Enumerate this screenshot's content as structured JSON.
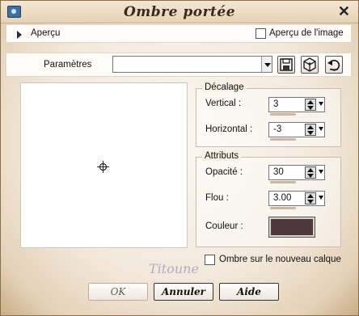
{
  "window": {
    "title": "Ombre portée",
    "close_glyph": "✕"
  },
  "apercu": {
    "label": "Aperçu",
    "image_preview_label": "Aperçu de l'image",
    "image_preview_checked": false
  },
  "presets": {
    "label": "Paramètres",
    "selected": ""
  },
  "offset": {
    "title": "Décalage",
    "vertical_label": "Vertical :",
    "vertical_value": "3",
    "horizontal_label": "Horizontal :",
    "horizontal_value": "-3"
  },
  "attributes": {
    "title": "Attributs",
    "opacity_label": "Opacité :",
    "opacity_value": "30",
    "blur_label": "Flou :",
    "blur_value": "3.00",
    "color_label": "Couleur :",
    "color_hex": "#4e3a3d"
  },
  "new_layer": {
    "label": "Ombre sur le nouveau calque",
    "checked": false
  },
  "watermark": "Titoune",
  "buttons": {
    "ok": "OK",
    "cancel": "Annuler",
    "help": "Aide"
  },
  "icons": {
    "app": "app-icon",
    "save": "save-icon",
    "cube": "cube-icon",
    "reset": "reset-icon",
    "crosshair": "crosshair-icon"
  }
}
